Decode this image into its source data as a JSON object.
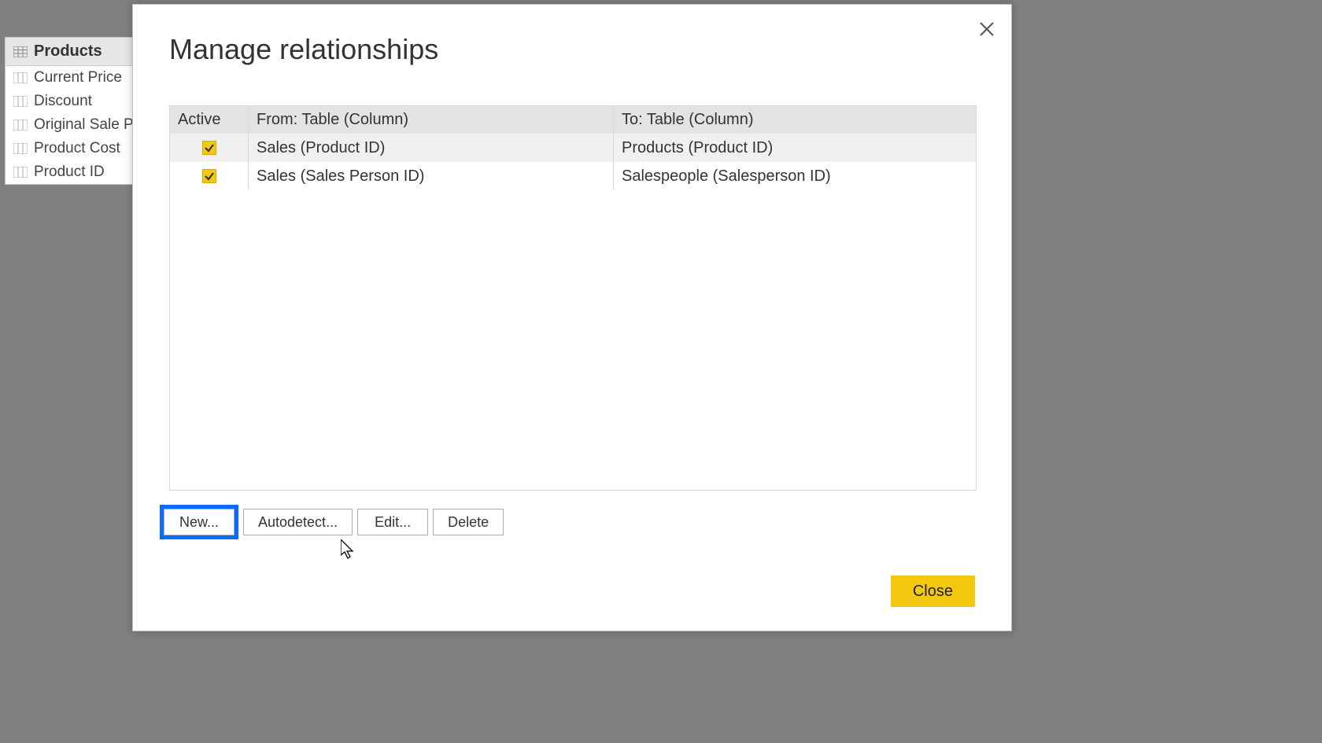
{
  "fields_panel": {
    "table_name": "Products",
    "fields": [
      "Current Price",
      "Discount",
      "Original Sale Pri",
      "Product Cost",
      "Product ID"
    ]
  },
  "dialog": {
    "title": "Manage relationships",
    "grid": {
      "headers": {
        "active": "Active",
        "from": "From: Table (Column)",
        "to": "To: Table (Column)"
      },
      "rows": [
        {
          "active": true,
          "from": "Sales (Product ID)",
          "to": "Products (Product ID)",
          "selected": true
        },
        {
          "active": true,
          "from": "Sales (Sales Person ID)",
          "to": "Salespeople (Salesperson ID)",
          "selected": false
        }
      ]
    },
    "buttons": {
      "new": "New...",
      "autodetect": "Autodetect...",
      "edit": "Edit...",
      "delete": "Delete",
      "close": "Close"
    }
  }
}
